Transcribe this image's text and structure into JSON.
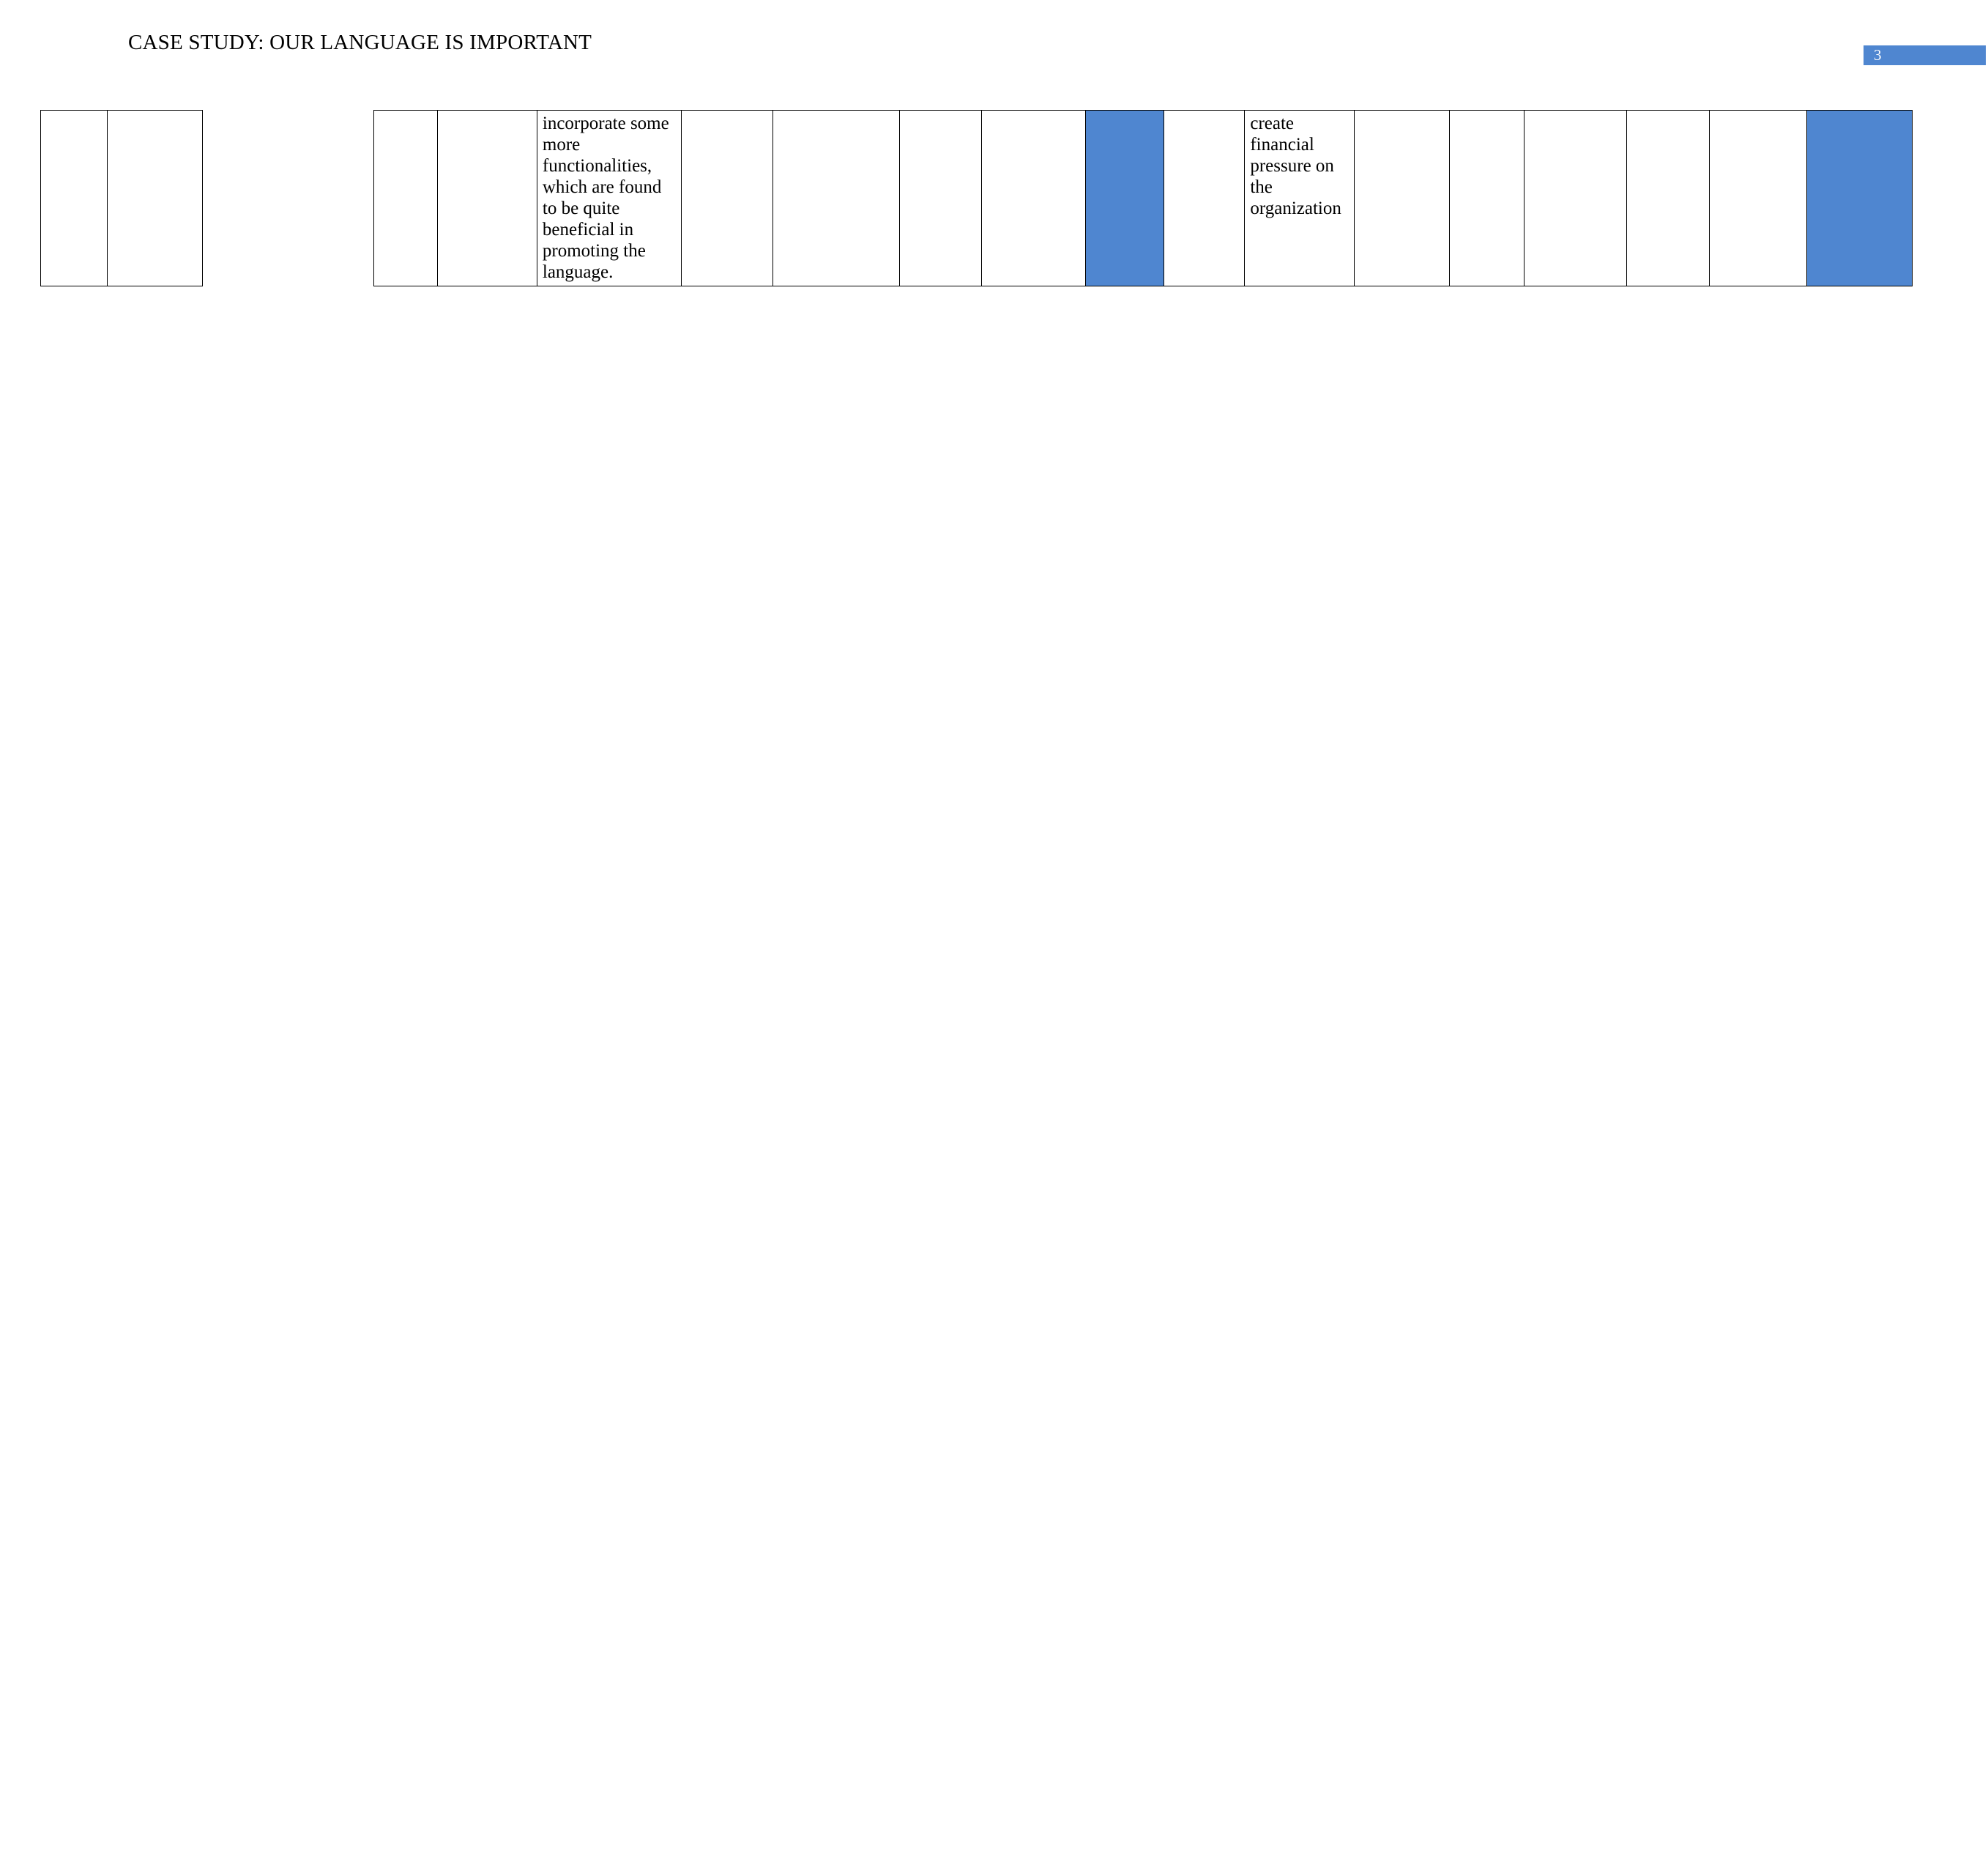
{
  "page": {
    "title": "CASE STUDY: OUR LANGUAGE IS IMPORTANT",
    "page_number": "3",
    "accent_color": "#4f86d0",
    "background_color": "#ffffff",
    "border_color": "#000000",
    "text_color": "#000000",
    "badge_text_color": "#ffffff"
  },
  "left_table": {
    "name": "left-empty-table",
    "rows": [
      {
        "cells": [
          {
            "text": "",
            "filled": false
          },
          {
            "text": "",
            "filled": false
          }
        ]
      }
    ]
  },
  "main_table": {
    "name": "main-content-table",
    "rows": [
      {
        "cells": [
          {
            "text": "",
            "filled": false
          },
          {
            "text": "",
            "filled": false
          },
          {
            "text": "incorporate some more functionalities, which are found to be quite beneficial in promoting the language.",
            "filled": false
          },
          {
            "text": "",
            "filled": false
          },
          {
            "text": "",
            "filled": false
          },
          {
            "text": "",
            "filled": false
          },
          {
            "text": "",
            "filled": false
          },
          {
            "text": "",
            "filled": true
          },
          {
            "text": "",
            "filled": false
          },
          {
            "text": "create financial pressure on the organization",
            "filled": false
          },
          {
            "text": "",
            "filled": false
          },
          {
            "text": "",
            "filled": false
          },
          {
            "text": "",
            "filled": false
          },
          {
            "text": "",
            "filled": false
          },
          {
            "text": "",
            "filled": false
          },
          {
            "text": "",
            "filled": true
          }
        ]
      }
    ]
  },
  "column_widths": {
    "left_table": [
      91,
      131
    ],
    "main_table": [
      87,
      136,
      197,
      125,
      173,
      112,
      143,
      107,
      110,
      150,
      130,
      102,
      140,
      113,
      133,
      144
    ]
  }
}
